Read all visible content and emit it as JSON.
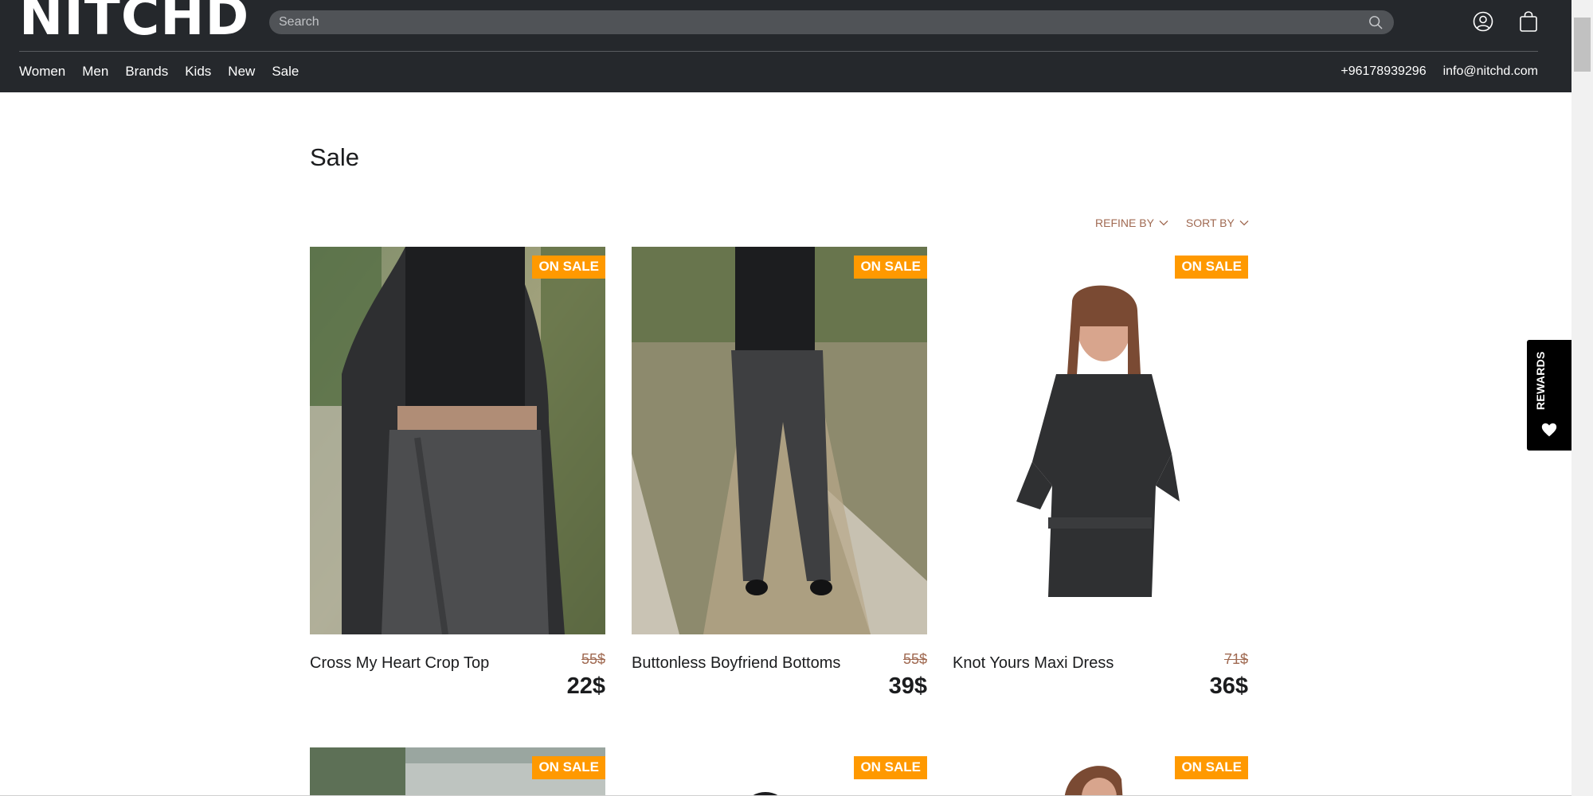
{
  "header": {
    "logo": "NITCHD",
    "search_placeholder": "Search",
    "nav": [
      "Women",
      "Men",
      "Brands",
      "Kids",
      "New",
      "Sale"
    ],
    "phone": "+96178939296",
    "email": "info@nitchd.com"
  },
  "page": {
    "title": "Sale",
    "refine_label": "REFINE BY",
    "sort_label": "SORT BY"
  },
  "badge_label": "ON SALE",
  "products": [
    {
      "name": "Cross My Heart Crop Top",
      "old_price": "55$",
      "price": "22$"
    },
    {
      "name": "Buttonless Boyfriend Bottoms",
      "old_price": "55$",
      "price": "39$"
    },
    {
      "name": "Knot Yours Maxi Dress",
      "old_price": "71$",
      "price": "36$"
    }
  ],
  "rewards_label": "REWARDS",
  "colors": {
    "header_bg": "#25282c",
    "badge": "#ff9900",
    "accent_text": "#a06a52"
  }
}
